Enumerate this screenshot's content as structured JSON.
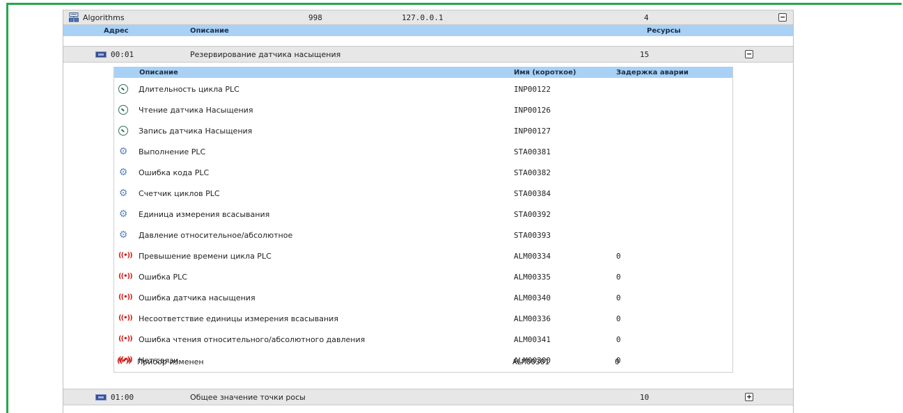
{
  "group": {
    "name": "Algorithms",
    "id": "998",
    "ip": "127.0.0.1",
    "resources": "4",
    "toggle": "−"
  },
  "columns": {
    "address": "Адрес",
    "description": "Описание",
    "resources": "Ресурсы"
  },
  "devices": [
    {
      "address": "00:01",
      "description": "Резервирование датчика насыщения",
      "resources": "15",
      "toggle": "−"
    },
    {
      "address": "01:00",
      "description": "Общее значение точки росы",
      "resources": "10",
      "toggle": "+"
    }
  ],
  "inner_columns": {
    "description": "Описание",
    "short_name": "Имя (короткое)",
    "alarm_delay": "Задержка аварии"
  },
  "variables": [
    {
      "type": "gauge-icon",
      "description": "Длительность цикла PLC",
      "short_name": "INP00122",
      "delay": ""
    },
    {
      "type": "gauge-icon",
      "description": "Чтение датчика Насыщения",
      "short_name": "INP00126",
      "delay": ""
    },
    {
      "type": "gauge-icon",
      "description": "Запись датчика Насыщения",
      "short_name": "INP00127",
      "delay": ""
    },
    {
      "type": "gear-icon",
      "description": "Выполнение PLC",
      "short_name": "STA00381",
      "delay": ""
    },
    {
      "type": "gear-icon",
      "description": "Ошибка кода PLC",
      "short_name": "STA00382",
      "delay": ""
    },
    {
      "type": "gear-icon",
      "description": "Счетчик циклов PLC",
      "short_name": "STA00384",
      "delay": ""
    },
    {
      "type": "gear-icon",
      "description": "Единица измерения всасывания",
      "short_name": "STA00392",
      "delay": ""
    },
    {
      "type": "gear-icon",
      "description": "Давление относительное/абсолютное",
      "short_name": "STA00393",
      "delay": ""
    },
    {
      "type": "alarm-icon",
      "description": "Превышение времени цикла PLC",
      "short_name": "ALM00334",
      "delay": "0"
    },
    {
      "type": "alarm-icon",
      "description": "Ошибка PLC",
      "short_name": "ALM00335",
      "delay": "0"
    },
    {
      "type": "alarm-icon",
      "description": "Ошибка датчика насыщения",
      "short_name": "ALM00340",
      "delay": "0"
    },
    {
      "type": "alarm-icon",
      "description": "Несоответствие единицы измерения всасывания",
      "short_name": "ALM00336",
      "delay": "0"
    },
    {
      "type": "alarm-icon",
      "description": "Ошибка чтения относительного/абсолютного давления",
      "short_name": "ALM00341",
      "delay": "0"
    },
    {
      "type": "alarm-icon",
      "description": "Нет связи",
      "short_name": "ALM00300",
      "delay": "0"
    },
    {
      "type": "alarm-icon",
      "description": "Прибор изменен",
      "short_name": "ALM00301",
      "delay": "0"
    }
  ],
  "colors": {
    "frame_accent": "#22a84a",
    "header_blue": "#a9d1f5",
    "row_gray": "#e7e7e7",
    "alarm_red": "#d0211d",
    "gear_blue": "#5b85c2"
  }
}
